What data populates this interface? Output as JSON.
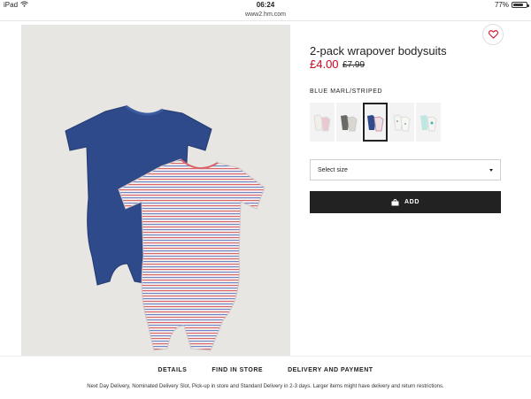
{
  "status_bar": {
    "device": "iPad",
    "time": "06:24",
    "battery": "77%",
    "battery_level": 0.77
  },
  "browser": {
    "url": "www2.hm.com"
  },
  "product": {
    "title": "2-pack wrapover bodysuits",
    "price": "£4.00",
    "old_price": "£7.99",
    "color_name": "BLUE MARL/STRIPED",
    "swatches": [
      {
        "name": "white-set",
        "selected": false
      },
      {
        "name": "grey-set",
        "selected": false
      },
      {
        "name": "blue-marl-striped",
        "selected": true
      },
      {
        "name": "white-print",
        "selected": false
      },
      {
        "name": "mint-print",
        "selected": false
      }
    ],
    "size_select": {
      "label": "Select size"
    },
    "add_button": {
      "label": "ADD"
    }
  },
  "colors": {
    "price": "#d0021b",
    "button": "#222222",
    "image_bg": "#e7e6e2"
  },
  "tabs": [
    "DETAILS",
    "FIND IN STORE",
    "DELIVERY AND PAYMENT"
  ],
  "delivery_note": "Next Day Delivery, Nominated Delivery Slot, Pick-up in store and Standard Delivery in 2-3 days. Larger items might have delivery and return restrictions."
}
